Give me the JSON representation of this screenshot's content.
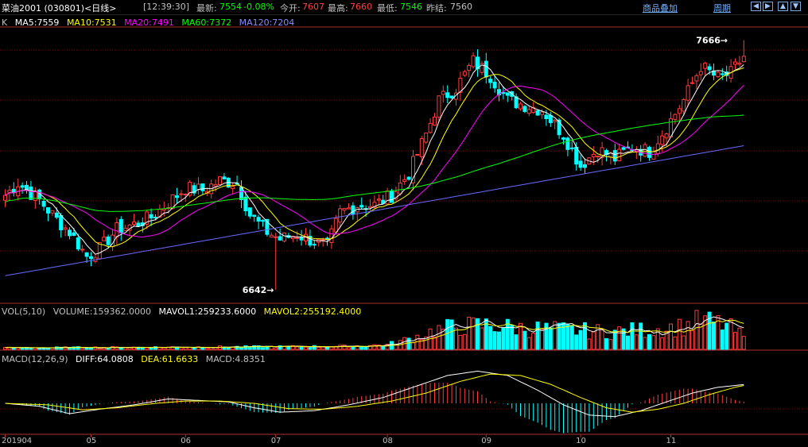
{
  "header": {
    "symbol": "菜油2001 (030801)<日线>",
    "time": "[12:39:30]",
    "latest_label": "最新:",
    "latest_value": "7554",
    "change": "-0.08%",
    "open_label": "今开:",
    "open_value": "7607",
    "high_label": "最高:",
    "high_value": "7660",
    "low_label": "最低:",
    "low_value": "7546",
    "prev_close_label": "昨结:",
    "prev_close_value": "7560",
    "overlay_link": "商品叠加",
    "period_link": "周期",
    "btn_left": "◀",
    "btn_right": "▶",
    "btn_up": "▲",
    "btn_down": "▼"
  },
  "colors": {
    "up": "#ff3b3b",
    "down": "#00ffff",
    "ma5": "#ffffff",
    "ma10": "#ffff00",
    "ma20": "#ff00ff",
    "ma60": "#00ff00",
    "ma120": "#6a6aff",
    "grid": "#8b0000",
    "macd_diff": "#ffffff",
    "macd_dea": "#ffff00"
  },
  "chart_data": [
    {
      "type": "candlestick",
      "panel": "price",
      "legend_prefix": "K",
      "legend": [
        {
          "key": "ma5",
          "text": "MA5:7559"
        },
        {
          "key": "ma10",
          "text": "MA10:7531"
        },
        {
          "key": "ma20",
          "text": "MA20:7491"
        },
        {
          "key": "ma60",
          "text": "MA60:7372"
        },
        {
          "key": "ma120",
          "text": "MA120:7204"
        }
      ],
      "ylim": [
        6600,
        7720
      ],
      "annotations": [
        {
          "text": "7666→",
          "value": 7666,
          "note": "high"
        },
        {
          "text": "6642→",
          "value": 6642,
          "note": "low"
        }
      ],
      "x_ticks": [
        "201904",
        "05",
        "06",
        "07",
        "08",
        "09",
        "10",
        "11"
      ],
      "x_tick_index": [
        0,
        20,
        42,
        63,
        89,
        112,
        134,
        155
      ],
      "anchors_close": [
        [
          0,
          7030
        ],
        [
          3,
          7080
        ],
        [
          8,
          7010
        ],
        [
          12,
          6930
        ],
        [
          15,
          6880
        ],
        [
          19,
          6780
        ],
        [
          22,
          6810
        ],
        [
          26,
          6890
        ],
        [
          30,
          6910
        ],
        [
          34,
          6940
        ],
        [
          38,
          7000
        ],
        [
          42,
          7060
        ],
        [
          46,
          7050
        ],
        [
          50,
          7090
        ],
        [
          54,
          7080
        ],
        [
          57,
          6950
        ],
        [
          61,
          6880
        ],
        [
          64,
          6850
        ],
        [
          68,
          6870
        ],
        [
          72,
          6840
        ],
        [
          75,
          6820
        ],
        [
          78,
          6960
        ],
        [
          82,
          6990
        ],
        [
          86,
          6990
        ],
        [
          90,
          7030
        ],
        [
          94,
          7120
        ],
        [
          98,
          7280
        ],
        [
          101,
          7420
        ],
        [
          105,
          7470
        ],
        [
          109,
          7580
        ],
        [
          113,
          7520
        ],
        [
          117,
          7420
        ],
        [
          121,
          7400
        ],
        [
          125,
          7380
        ],
        [
          130,
          7280
        ],
        [
          134,
          7150
        ],
        [
          138,
          7220
        ],
        [
          142,
          7180
        ],
        [
          146,
          7230
        ],
        [
          150,
          7210
        ],
        [
          154,
          7310
        ],
        [
          158,
          7420
        ],
        [
          162,
          7560
        ],
        [
          166,
          7510
        ],
        [
          169,
          7530
        ],
        [
          172,
          7600
        ]
      ],
      "price_low_index": 63,
      "price_high_index": 172
    },
    {
      "type": "bar",
      "panel": "volume",
      "legend": [
        {
          "key": "vol",
          "text": "VOL(5,10)"
        },
        {
          "key": "volume",
          "text": "VOLUME:159362.0000"
        },
        {
          "key": "mavol1",
          "text": "MAVOL1:259233.6000"
        },
        {
          "key": "mavol2",
          "text": "MAVOL2:255192.4000"
        }
      ],
      "anchors_volume": [
        [
          0,
          20000
        ],
        [
          20,
          25000
        ],
        [
          42,
          30000
        ],
        [
          63,
          35000
        ],
        [
          80,
          40000
        ],
        [
          89,
          60000
        ],
        [
          95,
          150000
        ],
        [
          100,
          250000
        ],
        [
          105,
          300000
        ],
        [
          112,
          320000
        ],
        [
          120,
          280000
        ],
        [
          130,
          260000
        ],
        [
          140,
          230000
        ],
        [
          150,
          260000
        ],
        [
          158,
          300000
        ],
        [
          162,
          380000
        ],
        [
          168,
          320000
        ],
        [
          172,
          160000
        ]
      ]
    },
    {
      "type": "line",
      "panel": "macd",
      "legend": [
        {
          "key": "macd",
          "text": "MACD(12,26,9)"
        },
        {
          "key": "diff",
          "text": "DIFF:64.0808"
        },
        {
          "key": "dea",
          "text": "DEA:61.6633"
        },
        {
          "key": "hist",
          "text": "MACD:4.8351"
        }
      ],
      "ylim": [
        -100,
        130
      ],
      "anchors_diff": [
        [
          0,
          0
        ],
        [
          8,
          -10
        ],
        [
          15,
          -35
        ],
        [
          22,
          -20
        ],
        [
          30,
          -5
        ],
        [
          38,
          15
        ],
        [
          45,
          10
        ],
        [
          52,
          5
        ],
        [
          58,
          -15
        ],
        [
          64,
          -30
        ],
        [
          72,
          -25
        ],
        [
          80,
          -5
        ],
        [
          88,
          20
        ],
        [
          96,
          60
        ],
        [
          103,
          95
        ],
        [
          110,
          110
        ],
        [
          117,
          95
        ],
        [
          124,
          45
        ],
        [
          130,
          -5
        ],
        [
          136,
          -40
        ],
        [
          142,
          -45
        ],
        [
          148,
          -25
        ],
        [
          154,
          5
        ],
        [
          160,
          35
        ],
        [
          166,
          55
        ],
        [
          172,
          64
        ]
      ],
      "anchors_dea": [
        [
          0,
          0
        ],
        [
          10,
          -5
        ],
        [
          18,
          -22
        ],
        [
          26,
          -15
        ],
        [
          35,
          0
        ],
        [
          42,
          8
        ],
        [
          50,
          8
        ],
        [
          58,
          0
        ],
        [
          66,
          -18
        ],
        [
          74,
          -20
        ],
        [
          82,
          -10
        ],
        [
          90,
          8
        ],
        [
          98,
          35
        ],
        [
          106,
          75
        ],
        [
          113,
          100
        ],
        [
          120,
          95
        ],
        [
          127,
          65
        ],
        [
          134,
          20
        ],
        [
          140,
          -15
        ],
        [
          146,
          -30
        ],
        [
          152,
          -20
        ],
        [
          158,
          0
        ],
        [
          164,
          30
        ],
        [
          170,
          55
        ],
        [
          172,
          61
        ]
      ]
    }
  ]
}
